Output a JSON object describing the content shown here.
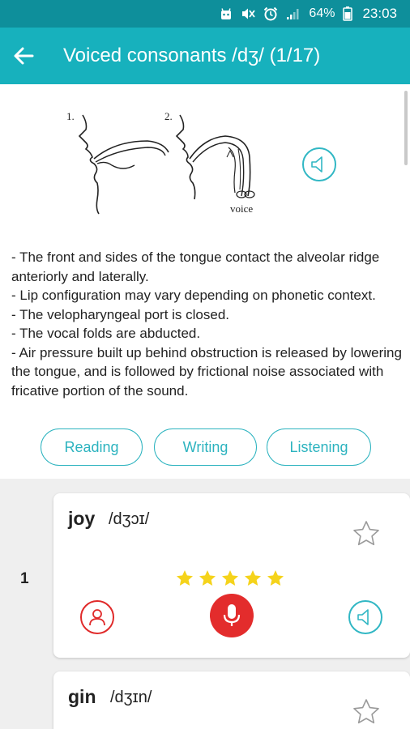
{
  "status_bar": {
    "battery_percent": "64%",
    "time": "23:03",
    "icons": [
      "android-head-icon",
      "mute-icon",
      "alarm-icon",
      "signal-icon",
      "battery-icon"
    ]
  },
  "app_bar": {
    "title": "Voiced consonants /dʒ/ (1/17)",
    "back_icon": "arrow-left-icon",
    "color": "#17b1bd"
  },
  "diagram": {
    "labels": {
      "step1": "1.",
      "step2": "2.",
      "voice": "voice"
    }
  },
  "description": [
    "- The front and sides of the tongue contact the alveolar ridge anteriorly and laterally.",
    "- Lip configuration may vary depending on phonetic context.",
    "- The velopharyngeal port is closed.",
    "- The vocal folds are abducted.",
    "- Air pressure built up behind obstruction is released by lowering the tongue, and is followed by frictional noise associated with fricative portion of the sound."
  ],
  "modes": {
    "reading": "Reading",
    "writing": "Writing",
    "listening": "Listening"
  },
  "words": [
    {
      "number": "1",
      "word": "joy",
      "ipa": "/dʒɔɪ/",
      "rating": 5,
      "max_rating": 5
    },
    {
      "word": "gin",
      "ipa": "/dʒɪn/"
    }
  ],
  "colors": {
    "accent": "#17b1bd",
    "status_bar": "#0e8f9b",
    "record": "#e32c2c",
    "rating_star": "#f5d31b"
  }
}
